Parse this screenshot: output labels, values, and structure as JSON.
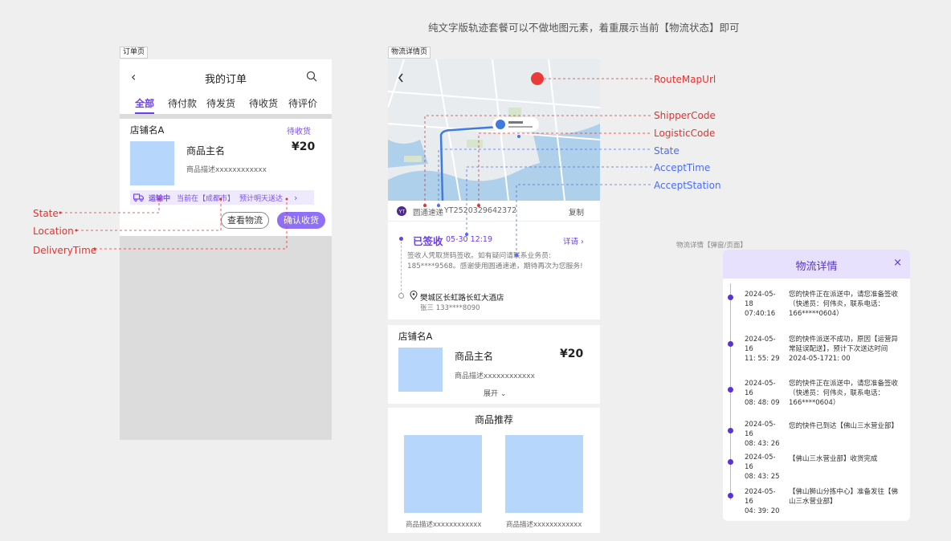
{
  "top_note": "纯文字版轨迹套餐可以不做地图元素，着重展示当前【物流状态】即可",
  "order_page": {
    "tag": "订单页",
    "title": "我的订单",
    "tabs": [
      "全部",
      "待付款",
      "待发货",
      "待收货",
      "待评价"
    ],
    "shop_name": "店铺名A",
    "status": "待收货",
    "product_name": "商品主名",
    "product_desc": "商品描述xxxxxxxxxxxx",
    "price": "¥20",
    "logistic_state": "运输中",
    "logistic_location": "当前在【成都市】",
    "logistic_eta": "预计明天送达",
    "btn_view": "查看物流",
    "btn_confirm": "确认收货"
  },
  "left_labels": {
    "state": "State",
    "location": "Location",
    "delivery_time": "DeliveryTime"
  },
  "detail_page": {
    "tag": "物流详情页",
    "courier": "圆通速递",
    "tracking_no": "YT2520329642372",
    "copy": "复制",
    "signed": "已签收",
    "signed_time": "05-30 12:19",
    "detail_link": "详请",
    "sign_text": "签收人凭取货码签收。如有疑问请联系业务员: 185****9568。感谢使用圆通速递，期待再次为您服务!",
    "address": "樊城区长虹路长虹大酒店",
    "receiver": "张三  133****8090",
    "shop_name": "店铺名A",
    "product_name": "商品主名",
    "product_desc": "商品描述xxxxxxxxxxxx",
    "price": "¥20",
    "expand": "展开",
    "recommend_title": "商品推荐",
    "rec_desc_1": "商品描述xxxxxxxxxxxx",
    "rec_desc_2": "商品描述xxxxxxxxxxxx"
  },
  "right_labels": [
    "RouteMapUrl",
    "ShipperCode",
    "LogisticCode",
    "State",
    "AcceptTime",
    "AcceptStation"
  ],
  "modal_tag": "物流详情【弹窗/页面】",
  "modal": {
    "title": "物流详情",
    "close": "×",
    "items": [
      {
        "date": "2024-05-18",
        "time": "07:40:16",
        "text": "您的快件正在派送中，请您准备签收（快递员：何伟炎，联系电话：166*****0604）"
      },
      {
        "date": "2024-05-16",
        "time": "11: 55: 29",
        "text": "您的快件派送不成功，原因【运营异常延误配送】，预计下次送达时间2024-05-1721: 00"
      },
      {
        "date": "2024-05-16",
        "time": "08: 48: 09",
        "text": "您的快件正在派送中，请您准备签收（快递员：何伟炎，联系电话：166****0604）"
      },
      {
        "date": "2024-05-16",
        "time": "08: 43: 26",
        "text": "您的快件已到达【佛山三水营业部】"
      },
      {
        "date": "2024-05-16",
        "time": "08: 43: 25",
        "text": "【佛山三水营业部】收货完成"
      },
      {
        "date": "2024-05-16",
        "time": "04: 39: 20",
        "text": "【佛山狮山分拣中心】准备发往【佛山三水营业部】"
      }
    ]
  },
  "colors": {
    "accent": "#6b3ef0",
    "red": "#e6312f",
    "blue": "#4a6cf7",
    "thumb": "#b7d6fb"
  }
}
